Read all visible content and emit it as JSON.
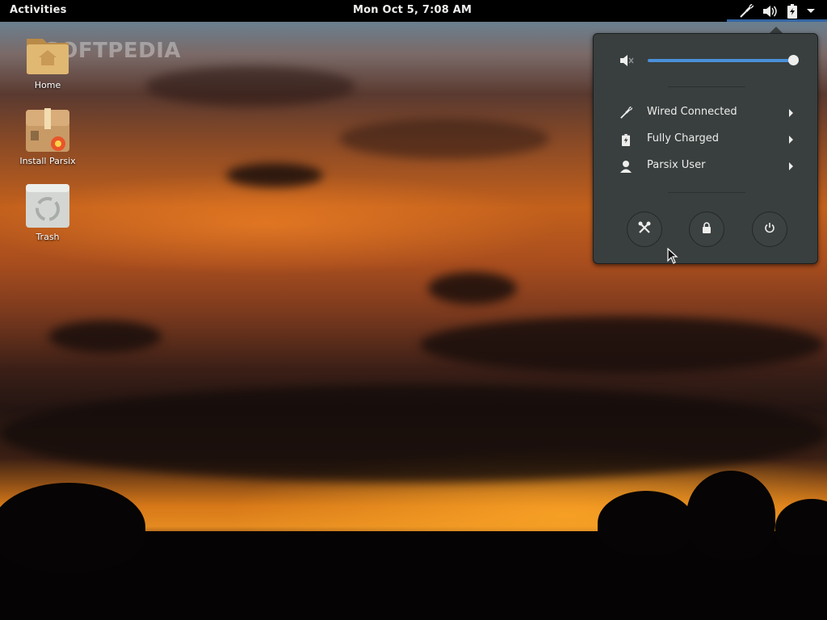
{
  "topbar": {
    "activities_label": "Activities",
    "clock": "Mon Oct  5,  7:08 AM",
    "tray_icons": [
      "network-wired-icon",
      "volume-icon",
      "battery-icon",
      "dropdown-arrow-icon"
    ]
  },
  "desktop": {
    "watermark": "SOFTPEDIA",
    "icons": [
      {
        "label": "Home",
        "icon": "home-folder-icon"
      },
      {
        "label": "Install Parsix",
        "icon": "installer-package-icon"
      },
      {
        "label": "Trash",
        "icon": "trash-icon"
      }
    ]
  },
  "system_menu": {
    "volume": {
      "icon": "volume-muted-icon",
      "level_percent": 100
    },
    "items": [
      {
        "label": "Wired Connected",
        "icon": "network-wired-icon"
      },
      {
        "label": "Fully Charged",
        "icon": "battery-icon"
      },
      {
        "label": "Parsix User",
        "icon": "user-icon"
      }
    ],
    "buttons": [
      {
        "name": "settings",
        "icon": "settings-tools-icon"
      },
      {
        "name": "lock",
        "icon": "lock-icon"
      },
      {
        "name": "power",
        "icon": "power-icon"
      }
    ]
  },
  "colors": {
    "topbar_bg": "#000000",
    "menu_bg": "#393f3f",
    "accent": "#4a90d9",
    "text": "#eeeeec"
  }
}
